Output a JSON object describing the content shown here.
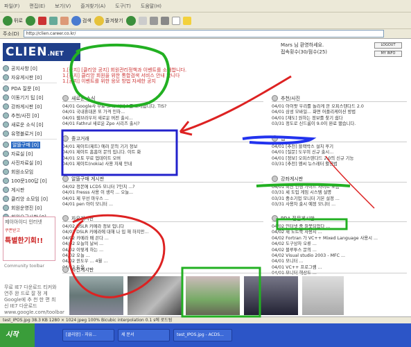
{
  "browser": {
    "menu": [
      "파일(F)",
      "편집(E)",
      "보기(V)",
      "즐겨찾기(A)",
      "도구(T)",
      "도움말(H)"
    ],
    "back_label": "뒤로",
    "search_label": "검색",
    "favorites_label": "즐겨찾기",
    "address_label": "주소(D)",
    "url": "http://clien.career.co.kr/",
    "status_text": "test_IPOS.jpg  38.3 KB  1280 × 1024  jpeg  100%  Bicubic interpolation  0.1 s에 로드됨"
  },
  "site": {
    "logo": "CLIEN",
    "logo_suffix": ".NET",
    "greeting": "Mars 님 환영하세요.",
    "points": "접속횟수(30/점수(25)",
    "logout_label": "LOGOUT",
    "myinfo_label": "MY INFO"
  },
  "sidebar": {
    "items": [
      {
        "label": "공지사항 [0]"
      },
      {
        "label": "자유게시판 [0]"
      },
      {
        "label": "PDA 질문 [0]"
      },
      {
        "label": "이동기기 팁 [0]"
      },
      {
        "label": "강좌게시판 [0]"
      },
      {
        "label": "추천/사진 [0]"
      },
      {
        "label": "새로운 소식 [0]"
      },
      {
        "label": "유명블로거 [0]"
      },
      {
        "label": "알뜰구매 [0]"
      },
      {
        "label": "자료실 [0]"
      },
      {
        "label": "사진자료실 [0]"
      },
      {
        "label": "회원소모임"
      },
      {
        "label": "100문100답 [0]"
      },
      {
        "label": "게시판"
      },
      {
        "label": "클리앙 소모임 [0]"
      },
      {
        "label": "회원운영진 [0]"
      },
      {
        "label": "회원요구사항 [0]"
      }
    ],
    "ad_title": "제이아이디 인터넷",
    "ad_sub": "쿠폰받고",
    "ad_big": "특별한기회!!",
    "community_title": "Community toolbar",
    "side_text": "무료 IE7 다운로드 티커와 연주 완 드로 잘 정 게 Google에 추 천 한 편 최신 IE7 다운로드 www.google.com/toolbar"
  },
  "notice": [
    "1.[공지] [클리앙 공지] 회원관리정책과 이벤트를 소개합니다.",
    "1.[공지] 클리앙 회원을 위한 통합검색 서비스 안내 합니다",
    "1.[공지] 이벤트를 위한 응모 방법 자세한 공지"
  ],
  "sections": {
    "news": {
      "title": "새로운 소식",
      "posts": [
        "04/01 Google사 무료 SMS 서비스를 소개합니다. TIS?",
        "04/01 국내휴대폰 또 가격 인하...",
        "04/01 웹브라우저 새로운 버전 출시...",
        "04/01 Fathrul 새로운 Zpo 시리즈 출시?"
      ]
    },
    "recommend": {
      "title": "추천/사진",
      "posts": [
        "04/01 아이팟 우리를 놀라게 한 오피스텐다드 2.0",
        "04/01 삼성 모바일... 화면 어플리케이션 방법",
        "04/01 [재도] 원하는 정보를 찾기 쉽다",
        "03/31 정도로 신드롬이 9.0이 완료 됐습니다."
      ]
    },
    "used": {
      "title": "중고거래",
      "posts": [
        "04/01 제이트(제트) 에러 문의 기기 정보",
        "04/01 제이트 흠흠이 문의 입니다. 이트 화",
        "04/01 오토 무료 업데이트 오버",
        "04/01 제이트(nokia) 사용 자제 안내"
      ]
    },
    "tips": {
      "title": "팁",
      "posts": [
        "04/01 [추천] 블랙박스 설치 후기",
        "04/01 [질문] 도우미 신규 출시...",
        "04/01 [정보] 오피스텐다드 2.0의 신규 기능",
        "03/31 [추천] 엠씨 뉴스레터 활용법"
      ]
    },
    "deals": {
      "title": "알뜰구매 게시판",
      "posts": [
        "04/02 정몬에 LCD5 모니터 7인치 ...?",
        "04/01 Fresss 사용 이 생각 ... 오늘...",
        "04/01 제 무선 마우스 ...",
        "04/01 pen 아이 모니터 ..."
      ]
    },
    "strong": {
      "title": "강좌게시판",
      "posts": [
        "04/01 최신 인생 가이드 사이트 모음",
        "03/31 세 도입 게임 시스템 설명",
        "03/31 중소기업 모니터 기본 설정 ...",
        "03/31 사용자 출시 예정 모니터 ..."
      ]
    },
    "free": {
      "title": "자유게시판",
      "posts": [
        "04/02 DSLR 카메라 정보 입니다",
        "04/02 DSLR 카메라에 대해 나 입 해 하지만...",
        "04/02 카메라 배 쓴다 ...",
        "04/02 오늘의 날씨 ...",
        "04/02 이렇게 하는 ...",
        "04/02 오늘 ...",
        "04/02 윈도우 ... 4월 ...",
        "04/02 도움 ..."
      ]
    },
    "qna": {
      "title": "PDA 질문게시판",
      "posts": [
        "04/02 인터넷 중 잘못되었다 ...",
        "04/02 새 노트북 사용시 ...",
        "04/02 Fortran 가 VC++ Mixed Language 사용시 ...",
        "04/02 도구상자 오류 ...",
        "04/02 블루투스 문의 ...",
        "04/02 Visual studio 2003 - MFC ...",
        "04/01 모니터 ...",
        "04/01 VC++ 프로그램 ...",
        "04/01 모니터 해상도 ...",
        "04/01 ..."
      ]
    },
    "photos": {
      "title": "사진게시판"
    }
  },
  "taskbar": {
    "start": "시작",
    "items": [
      "[클리앙] - 자유...",
      "세 문서",
      "test_IPOS.jpg - ACDS..."
    ]
  }
}
